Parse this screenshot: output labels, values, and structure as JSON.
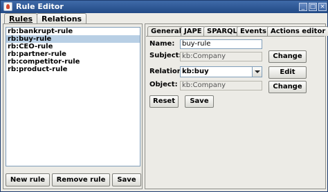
{
  "window": {
    "title": "Rule Editor"
  },
  "main_tabs": [
    {
      "label": "Rules"
    },
    {
      "label": "Relations"
    }
  ],
  "rules": [
    "rb:bankrupt-rule",
    "rb:buy-rule",
    "rb:CEO-rule",
    "rb:partner-rule",
    "rb:competitor-rule",
    "rb:product-rule"
  ],
  "selected_rule": "rb:buy-rule",
  "left_buttons": {
    "new": "New rule",
    "remove": "Remove rule",
    "save": "Save"
  },
  "editor_tabs": [
    "General",
    "JAPE",
    "SPARQL",
    "Events",
    "Actions editor"
  ],
  "form": {
    "name_label": "Name:",
    "name_value": "buy-rule",
    "subject_label": "Subject:",
    "subject_value": "kb:Company",
    "relation_label": "Relation:",
    "relation_value": "kb:buy",
    "object_label": "Object:",
    "object_value": "kb:Company",
    "change_label": "Change",
    "edit_label": "Edit",
    "reset_label": "Reset",
    "save_label": "Save"
  }
}
